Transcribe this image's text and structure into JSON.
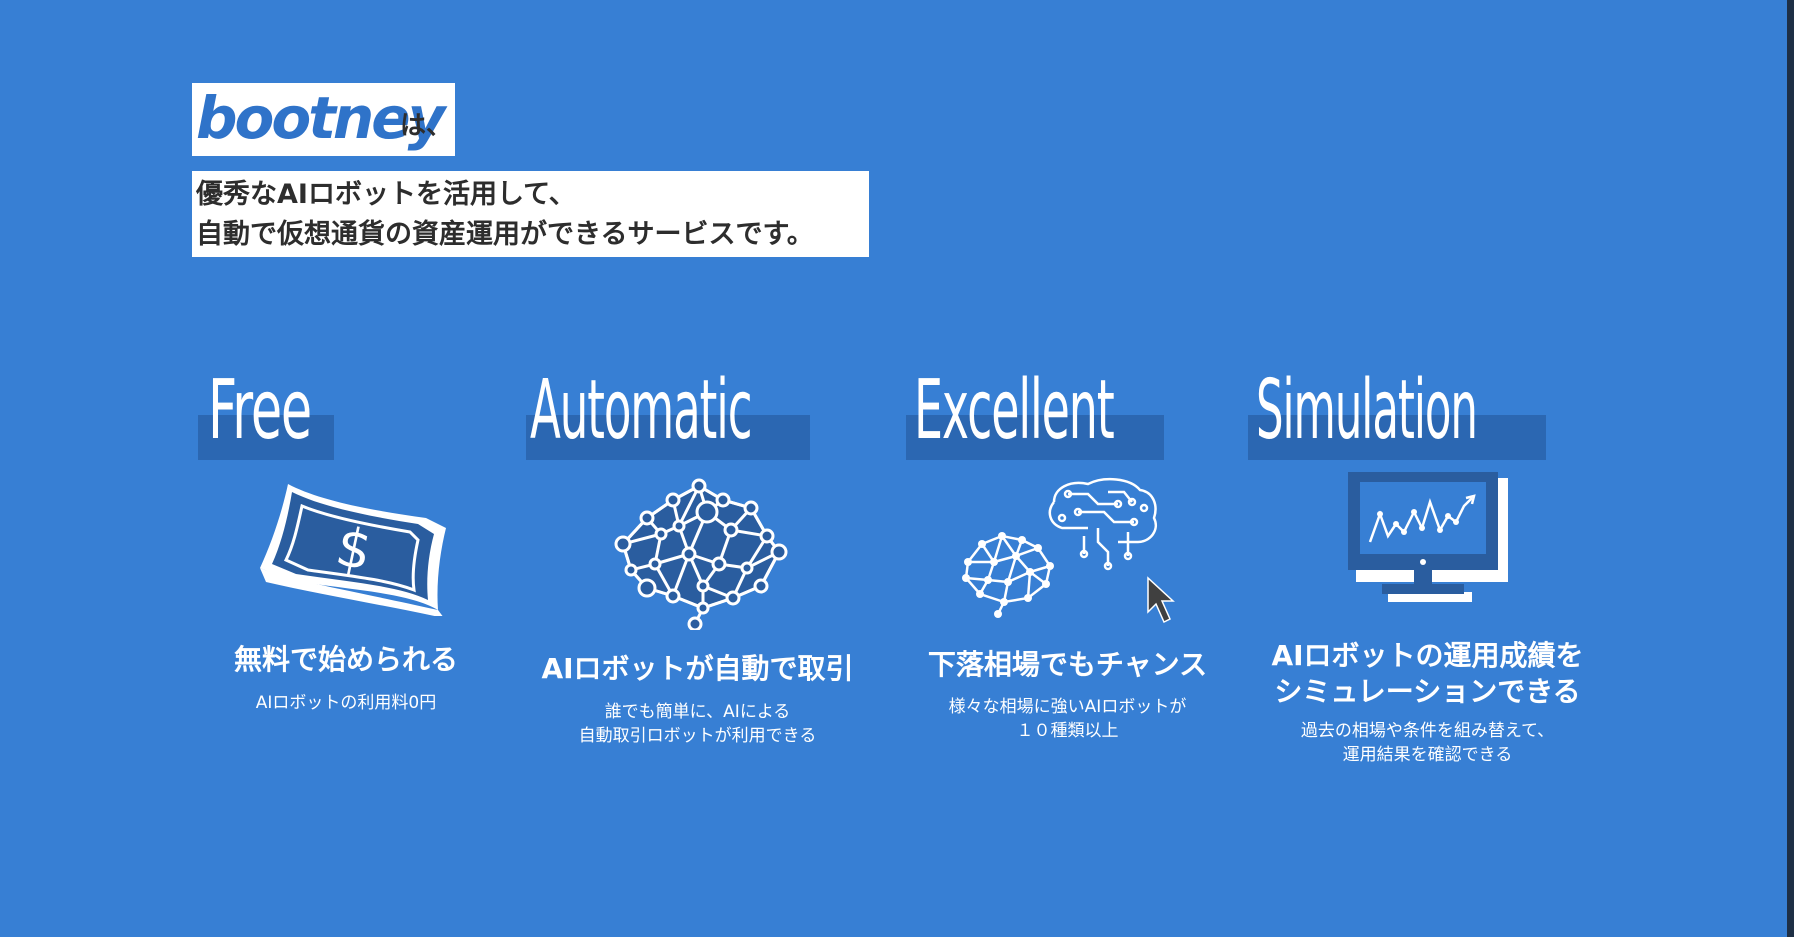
{
  "header": {
    "logo": "bootney",
    "logo_suffix": "は、",
    "tagline_lines": [
      "優秀なAIロボットを活用して、",
      "自動で仮想通貨の資産運用ができるサービスです。"
    ]
  },
  "features": [
    {
      "title": "Free",
      "icon": "money-bill-icon",
      "heading_lines": [
        "無料で始められる"
      ],
      "desc_lines": [
        "AIロボットの利用料0円"
      ]
    },
    {
      "title": "Automatic",
      "icon": "ai-brain-network-icon",
      "heading_lines": [
        "AIロボットが自動で取引"
      ],
      "desc_lines": [
        "誰でも簡単に、AIによる",
        "自動取引ロボットが利用できる"
      ]
    },
    {
      "title": "Excellent",
      "icon": "brains-circuit-cursor-icon",
      "heading_lines": [
        "下落相場でもチャンス"
      ],
      "desc_lines": [
        "様々な相場に強いAIロボットが",
        "１０種類以上"
      ]
    },
    {
      "title": "Simulation",
      "icon": "monitor-chart-icon",
      "heading_lines": [
        "AIロボットの運用成績を",
        "シミュレーションできる"
      ],
      "desc_lines": [
        "過去の相場や条件を組み替えて、",
        "運用結果を確認できる"
      ]
    }
  ],
  "colors": {
    "background": "#377fd4",
    "title_bar": "#2b67b2",
    "icon_dark": "#2a5d9f",
    "logo_blue": "#2f73c9",
    "text_dark": "#2d2d2d",
    "white": "#ffffff"
  }
}
